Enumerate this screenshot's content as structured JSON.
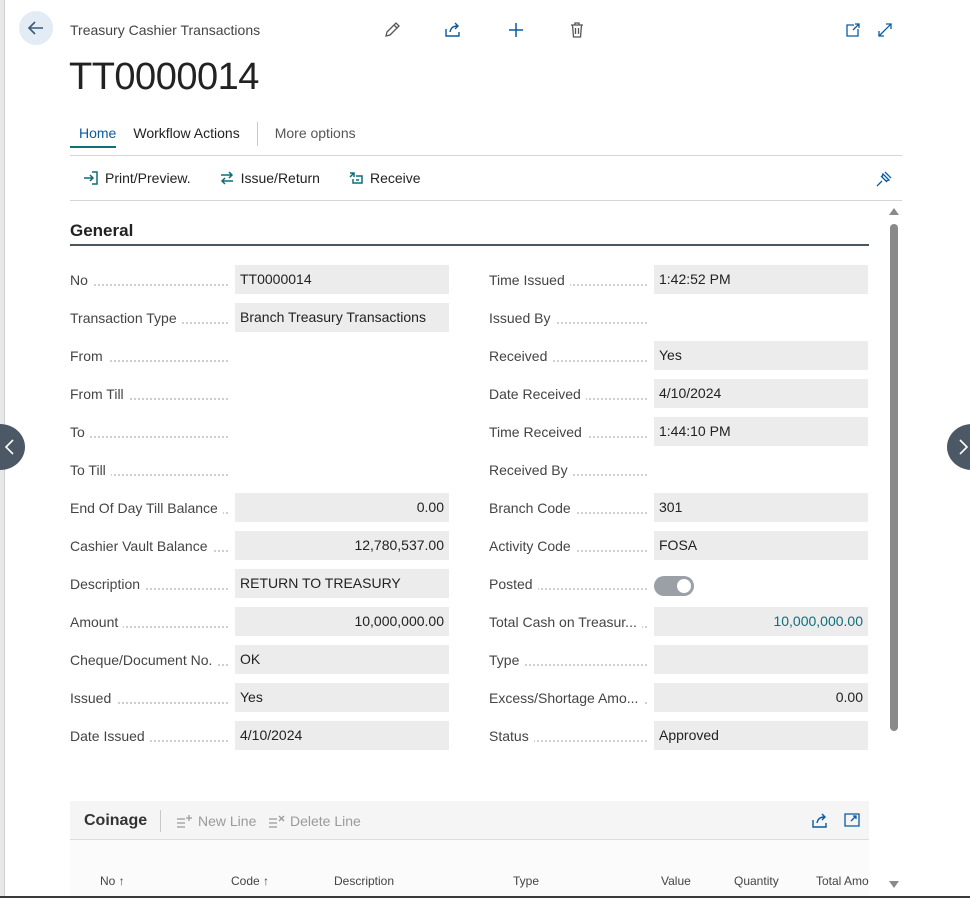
{
  "header": {
    "page_caption": "Treasury Cashier Transactions",
    "record_title": "TT0000014"
  },
  "tabs": [
    {
      "label": "Home"
    },
    {
      "label": "Workflow Actions"
    },
    {
      "label": "More options"
    }
  ],
  "actions": [
    {
      "label": "Print/Preview."
    },
    {
      "label": "Issue/Return"
    },
    {
      "label": "Receive"
    }
  ],
  "section": {
    "title": "General"
  },
  "fields_left": [
    {
      "label": "No",
      "value": "TT0000014"
    },
    {
      "label": "Transaction Type",
      "value": "Branch Treasury Transactions"
    },
    {
      "label": "From",
      "value": ""
    },
    {
      "label": "From Till",
      "value": ""
    },
    {
      "label": "To",
      "value": ""
    },
    {
      "label": "To Till",
      "value": ""
    },
    {
      "label": "End Of Day Till Balance",
      "value": "0.00"
    },
    {
      "label": "Cashier Vault Balance",
      "value": "12,780,537.00"
    },
    {
      "label": "Description",
      "value": "RETURN TO TREASURY"
    },
    {
      "label": "Amount",
      "value": "10,000,000.00"
    },
    {
      "label": "Cheque/Document No.",
      "value": "OK"
    },
    {
      "label": "Issued",
      "value": "Yes"
    },
    {
      "label": "Date Issued",
      "value": "4/10/2024"
    }
  ],
  "fields_right": [
    {
      "label": "Time Issued",
      "value": "1:42:52 PM"
    },
    {
      "label": "Issued By",
      "value": ""
    },
    {
      "label": "Received",
      "value": "Yes"
    },
    {
      "label": "Date Received",
      "value": "4/10/2024"
    },
    {
      "label": "Time Received",
      "value": "1:44:10 PM"
    },
    {
      "label": "Received By",
      "value": ""
    },
    {
      "label": "Branch Code",
      "value": "301"
    },
    {
      "label": "Activity Code",
      "value": "FOSA"
    },
    {
      "label": "Posted",
      "value": ""
    },
    {
      "label": "Total Cash on Treasur...",
      "value": "10,000,000.00"
    },
    {
      "label": "Type",
      "value": ""
    },
    {
      "label": "Excess/Shortage Amo...",
      "value": "0.00"
    },
    {
      "label": "Status",
      "value": "Approved"
    }
  ],
  "posted_toggle_on": true,
  "coinage": {
    "title": "Coinage",
    "new_line": "New Line",
    "delete_line": "Delete Line",
    "columns": [
      "No ↑",
      "Code ↑",
      "Description",
      "Type",
      "Value",
      "Quantity",
      "Total Amo"
    ]
  },
  "colors": {
    "accent": "#0f6f76",
    "link": "#0e6e7a",
    "field_bg": "#ececec"
  }
}
